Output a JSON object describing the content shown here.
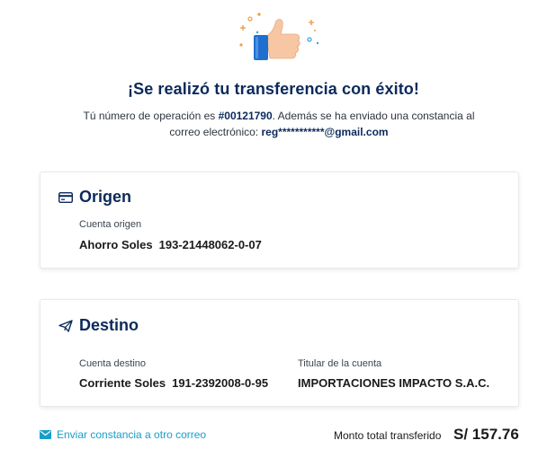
{
  "success": {
    "title": "¡Se realizó tu transferencia con éxito!",
    "line1_prefix": "Tú número de operación es ",
    "operation_number": "#00121790",
    "line1_suffix": ". Además se ha enviado una constancia al",
    "line2_prefix": "correo electrónico: ",
    "email": "reg***********@gmail.com"
  },
  "origen": {
    "title": "Origen",
    "icon": "card-icon",
    "account_label": "Cuenta origen",
    "account_type": "Ahorro Soles",
    "account_number": "193-21448062-0-07"
  },
  "destino": {
    "title": "Destino",
    "icon": "paper-plane-icon",
    "account_label": "Cuenta destino",
    "account_type": "Corriente Soles",
    "account_number": "191-2392008-0-95",
    "holder_label": "Titular de la cuenta",
    "holder_name": "IMPORTACIONES IMPACTO S.A.C."
  },
  "footer": {
    "resend_label": "Enviar constancia a otro correo",
    "resend_icon": "envelope-icon",
    "total_label": "Monto total transferido",
    "total_value": "S/ 157.76"
  },
  "colors": {
    "heading": "#0b2a5b",
    "link": "#1a9ec9",
    "thumb_blue": "#1f6fd1",
    "skin": "#f6c7a2"
  }
}
